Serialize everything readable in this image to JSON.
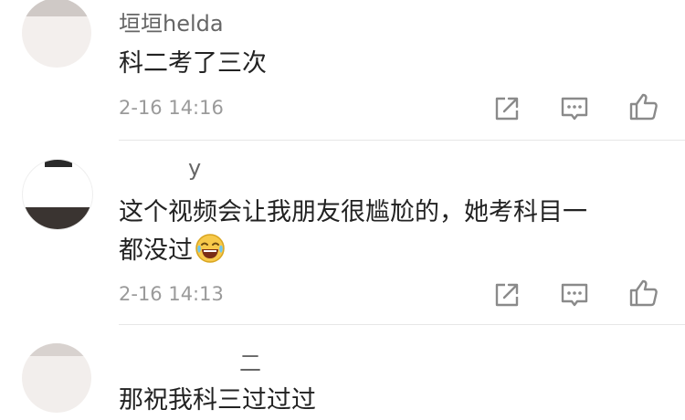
{
  "comments": [
    {
      "username": "垣垣helda",
      "text": "科二考了三次",
      "timestamp": "2-16 14:16",
      "icons": [
        "share-icon",
        "comment-icon",
        "like-icon"
      ]
    },
    {
      "username": "y",
      "text_line1": "这个视频会让我朋友很尴尬的，她考科目一",
      "text_line2": "都没过",
      "emoji": "laughing-tears-emoji",
      "timestamp": "2-16 14:13",
      "icons": [
        "share-icon",
        "comment-icon",
        "like-icon"
      ]
    },
    {
      "username": "二",
      "text": "那祝我科三过过过"
    }
  ],
  "colors": {
    "text": "#222222",
    "meta": "#9a9a9a",
    "icon": "#8a8a8a",
    "divider": "#e6e6e6"
  }
}
